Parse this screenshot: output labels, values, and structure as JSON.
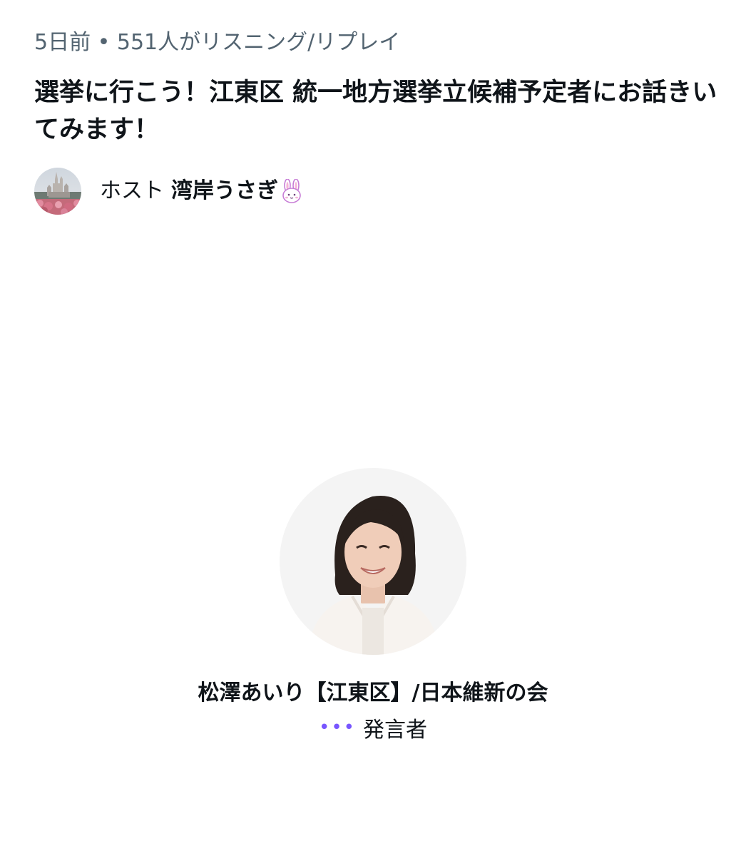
{
  "space": {
    "meta": "5日前 • 551人がリスニング/リプレイ",
    "title": "選挙に行こう！江東区 統一地方選挙立候補予定者にお話きいてみます！"
  },
  "host": {
    "label": "ホスト",
    "name": "湾岸うさぎ",
    "avatar_icon": "castle-photo-avatar",
    "name_emoji": "rabbit-face-icon"
  },
  "speaker": {
    "name": "松澤あいり【江東区】/日本維新の会",
    "role": "発言者",
    "status_icon": "speaking-dots-icon",
    "avatar_icon": "speaker-photo-avatar"
  },
  "colors": {
    "accent": "#7856ff",
    "secondary_text": "#536471",
    "primary_text": "#0f1419"
  }
}
